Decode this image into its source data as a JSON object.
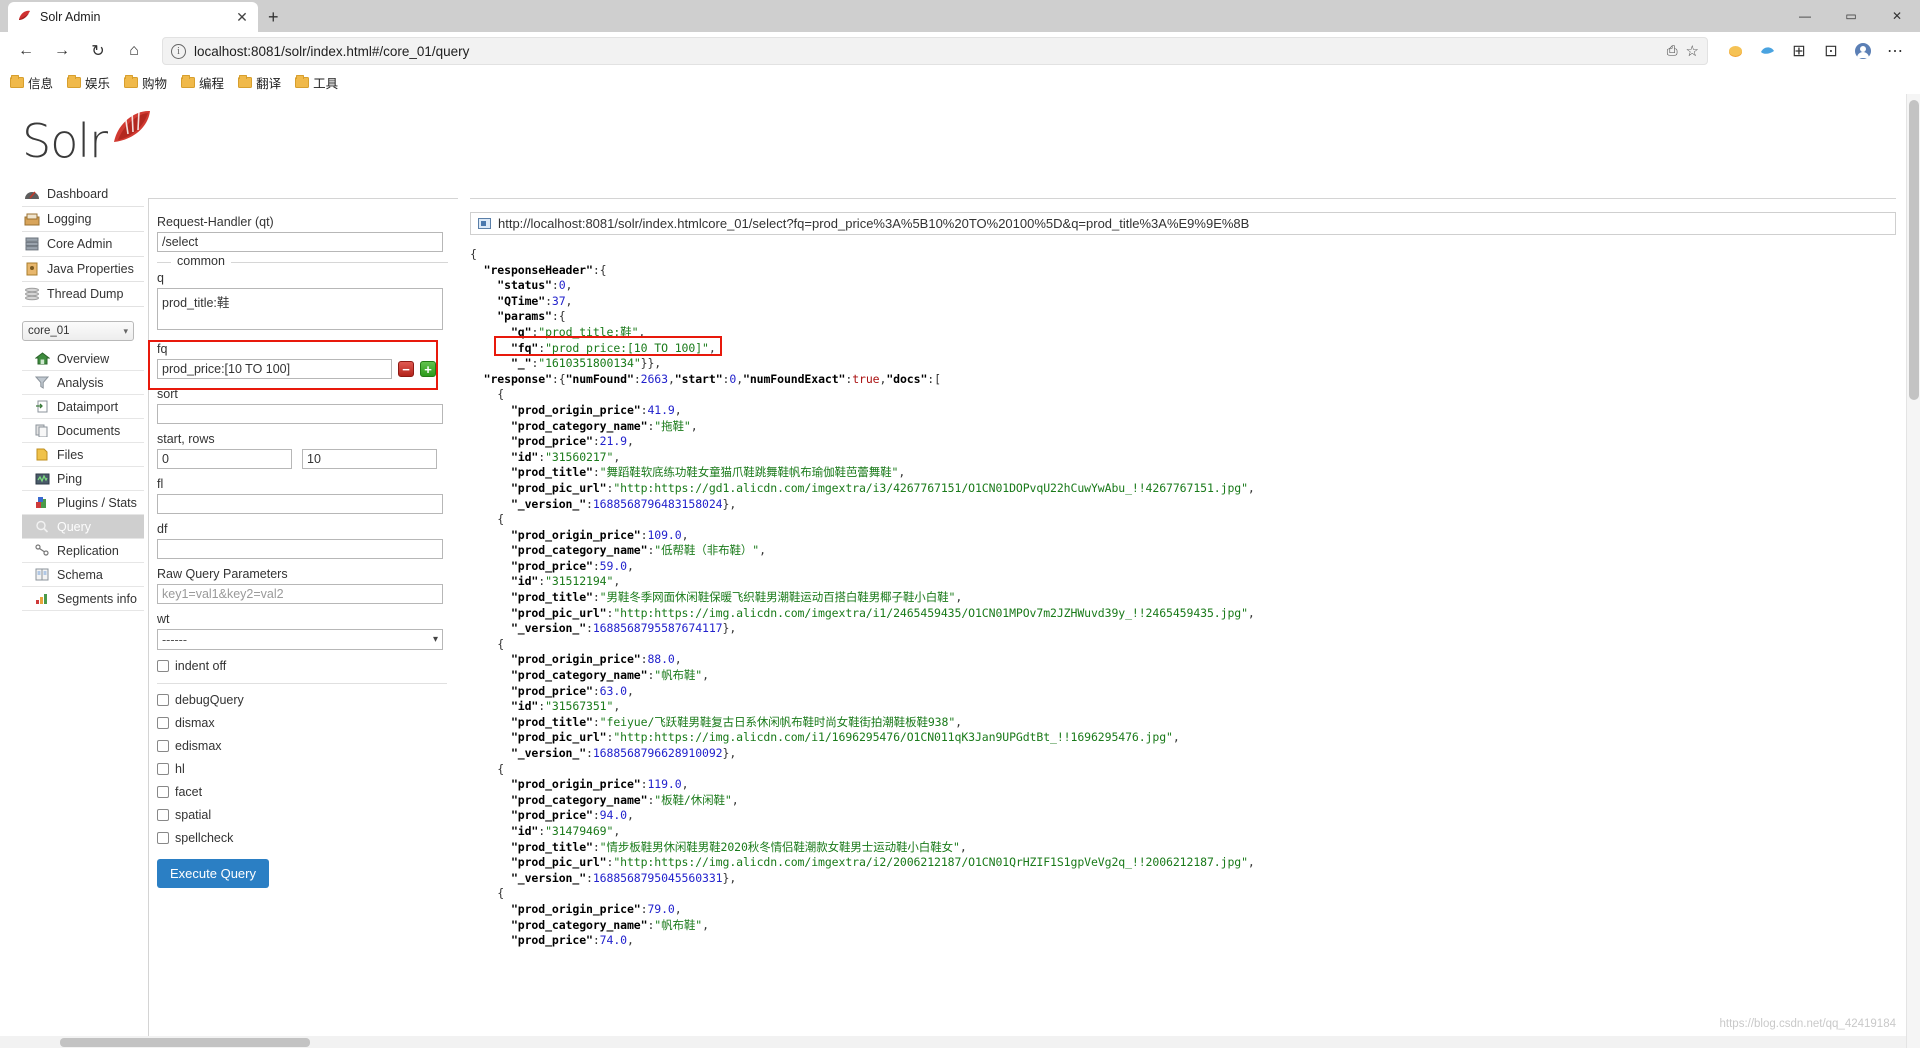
{
  "browser": {
    "tab_title": "Solr Admin",
    "tab_close": "✕",
    "new_tab": "+",
    "back": "←",
    "forward": "→",
    "reload": "↻",
    "home": "⌂",
    "url": "localhost:8081/solr/index.html#/core_01/query",
    "info_icon": "i",
    "read_aloud": "⎙",
    "favorite": "☆",
    "minimize": "—",
    "maximize": "▭",
    "close": "✕",
    "collections": "⊞",
    "favorites_hub": "⊡",
    "profile": "◉",
    "settings": "⋯",
    "bookmarks": [
      {
        "label": "信息"
      },
      {
        "label": "娱乐"
      },
      {
        "label": "购物"
      },
      {
        "label": "编程"
      },
      {
        "label": "翻译"
      },
      {
        "label": "工具"
      }
    ]
  },
  "solr": {
    "logo_text": "Solr",
    "global_nav": [
      {
        "label": "Dashboard",
        "icon": "dashboard-icon"
      },
      {
        "label": "Logging",
        "icon": "logging-icon"
      },
      {
        "label": "Core Admin",
        "icon": "core-admin-icon"
      },
      {
        "label": "Java Properties",
        "icon": "java-properties-icon"
      },
      {
        "label": "Thread Dump",
        "icon": "thread-dump-icon"
      }
    ],
    "core_selector": {
      "value": "core_01",
      "caret": "▾"
    },
    "core_nav": [
      {
        "label": "Overview",
        "icon": "home-icon",
        "active": false
      },
      {
        "label": "Analysis",
        "icon": "funnel-icon",
        "active": false
      },
      {
        "label": "Dataimport",
        "icon": "dataimport-icon",
        "active": false
      },
      {
        "label": "Documents",
        "icon": "documents-icon",
        "active": false
      },
      {
        "label": "Files",
        "icon": "files-icon",
        "active": false
      },
      {
        "label": "Ping",
        "icon": "ping-icon",
        "active": false
      },
      {
        "label": "Plugins / Stats",
        "icon": "plugins-icon",
        "active": false
      },
      {
        "label": "Query",
        "icon": "magnifier-icon",
        "active": true
      },
      {
        "label": "Replication",
        "icon": "replication-icon",
        "active": false
      },
      {
        "label": "Schema",
        "icon": "schema-icon",
        "active": false
      },
      {
        "label": "Segments info",
        "icon": "segments-icon",
        "active": false
      }
    ]
  },
  "query_form": {
    "request_handler_label": "Request-Handler (qt)",
    "request_handler_value": "/select",
    "common_legend": "common",
    "q_label": "q",
    "q_value": "prod_title:鞋",
    "fq_label": "fq",
    "fq_value": "prod_price:[10 TO 100]",
    "fq_remove": "−",
    "fq_add": "+",
    "sort_label": "sort",
    "sort_value": "",
    "start_rows_label": "start, rows",
    "start_value": "0",
    "rows_value": "10",
    "fl_label": "fl",
    "fl_value": "",
    "df_label": "df",
    "df_value": "",
    "raw_label": "Raw Query Parameters",
    "raw_placeholder": "key1=val1&key2=val2",
    "wt_label": "wt",
    "wt_value": "------",
    "wt_caret": "▾",
    "indent_off": "indent off",
    "checkboxes": [
      {
        "label": "debugQuery"
      },
      {
        "label": "dismax"
      },
      {
        "label": "edismax"
      },
      {
        "label": "hl"
      },
      {
        "label": "facet"
      },
      {
        "label": "spatial"
      },
      {
        "label": "spellcheck"
      }
    ],
    "execute_label": "Execute Query",
    "accent_blue": "#2b7fc4",
    "highlight_red": "#e8190c"
  },
  "result": {
    "url": "http://localhost:8081/solr/index.htmlcore_01/select?fq=prod_price%3A%5B10%20TO%20100%5D&q=prod_title%3A%E9%9E%8B",
    "response_header": {
      "status": 0,
      "QTime": 37,
      "params": {
        "q": "prod_title:鞋",
        "fq": "prod_price:[10 TO 100]",
        "_": "1610351800134"
      }
    },
    "response": {
      "numFound": 2663,
      "start": 0,
      "numFoundExact": true
    },
    "docs": [
      {
        "prod_origin_price": "41.9",
        "prod_category_name": "拖鞋",
        "prod_price": "21.9",
        "id": "31560217",
        "prod_title": "舞蹈鞋软底练功鞋女童猫爪鞋跳舞鞋帆布瑜伽鞋芭蕾舞鞋",
        "prod_pic_url": "http:https://gd1.alicdn.com/imgextra/i3/4267767151/O1CN01DOPvqU22hCuwYwAbu_!!4267767151.jpg",
        "_version_": "1688568796483158024"
      },
      {
        "prod_origin_price": "109.0",
        "prod_category_name": "低帮鞋（非布鞋）",
        "prod_price": "59.0",
        "id": "31512194",
        "prod_title": "男鞋冬季网面休闲鞋保暖飞织鞋男潮鞋运动百搭白鞋男椰子鞋小白鞋",
        "prod_pic_url": "http:https://img.alicdn.com/imgextra/i1/2465459435/O1CN01MPOv7m2JZHWuvd39y_!!2465459435.jpg",
        "_version_": "1688568795587674117"
      },
      {
        "prod_origin_price": "88.0",
        "prod_category_name": "帆布鞋",
        "prod_price": "63.0",
        "id": "31567351",
        "prod_title": "feiyue/飞跃鞋男鞋复古日系休闲帆布鞋时尚女鞋街拍潮鞋板鞋938",
        "prod_pic_url": "http:https://img.alicdn.com/i1/1696295476/O1CN011qK3Jan9UPGdtBt_!!1696295476.jpg",
        "_version_": "1688568796628910092"
      },
      {
        "prod_origin_price": "119.0",
        "prod_category_name": "板鞋/休闲鞋",
        "prod_price": "94.0",
        "id": "31479469",
        "prod_title": "情步板鞋男休闲鞋男鞋2020秋冬情侣鞋潮款女鞋男士运动鞋小白鞋女",
        "prod_pic_url": "http:https://img.alicdn.com/imgextra/i2/2006212187/O1CN01QrHZIF1S1gpVeVg2q_!!2006212187.jpg",
        "_version_": "1688568795045560331"
      },
      {
        "prod_origin_price": "79.0",
        "prod_category_name": "帆布鞋",
        "prod_price": "74.0"
      }
    ]
  },
  "watermark": "https://blog.csdn.net/qq_42419184"
}
